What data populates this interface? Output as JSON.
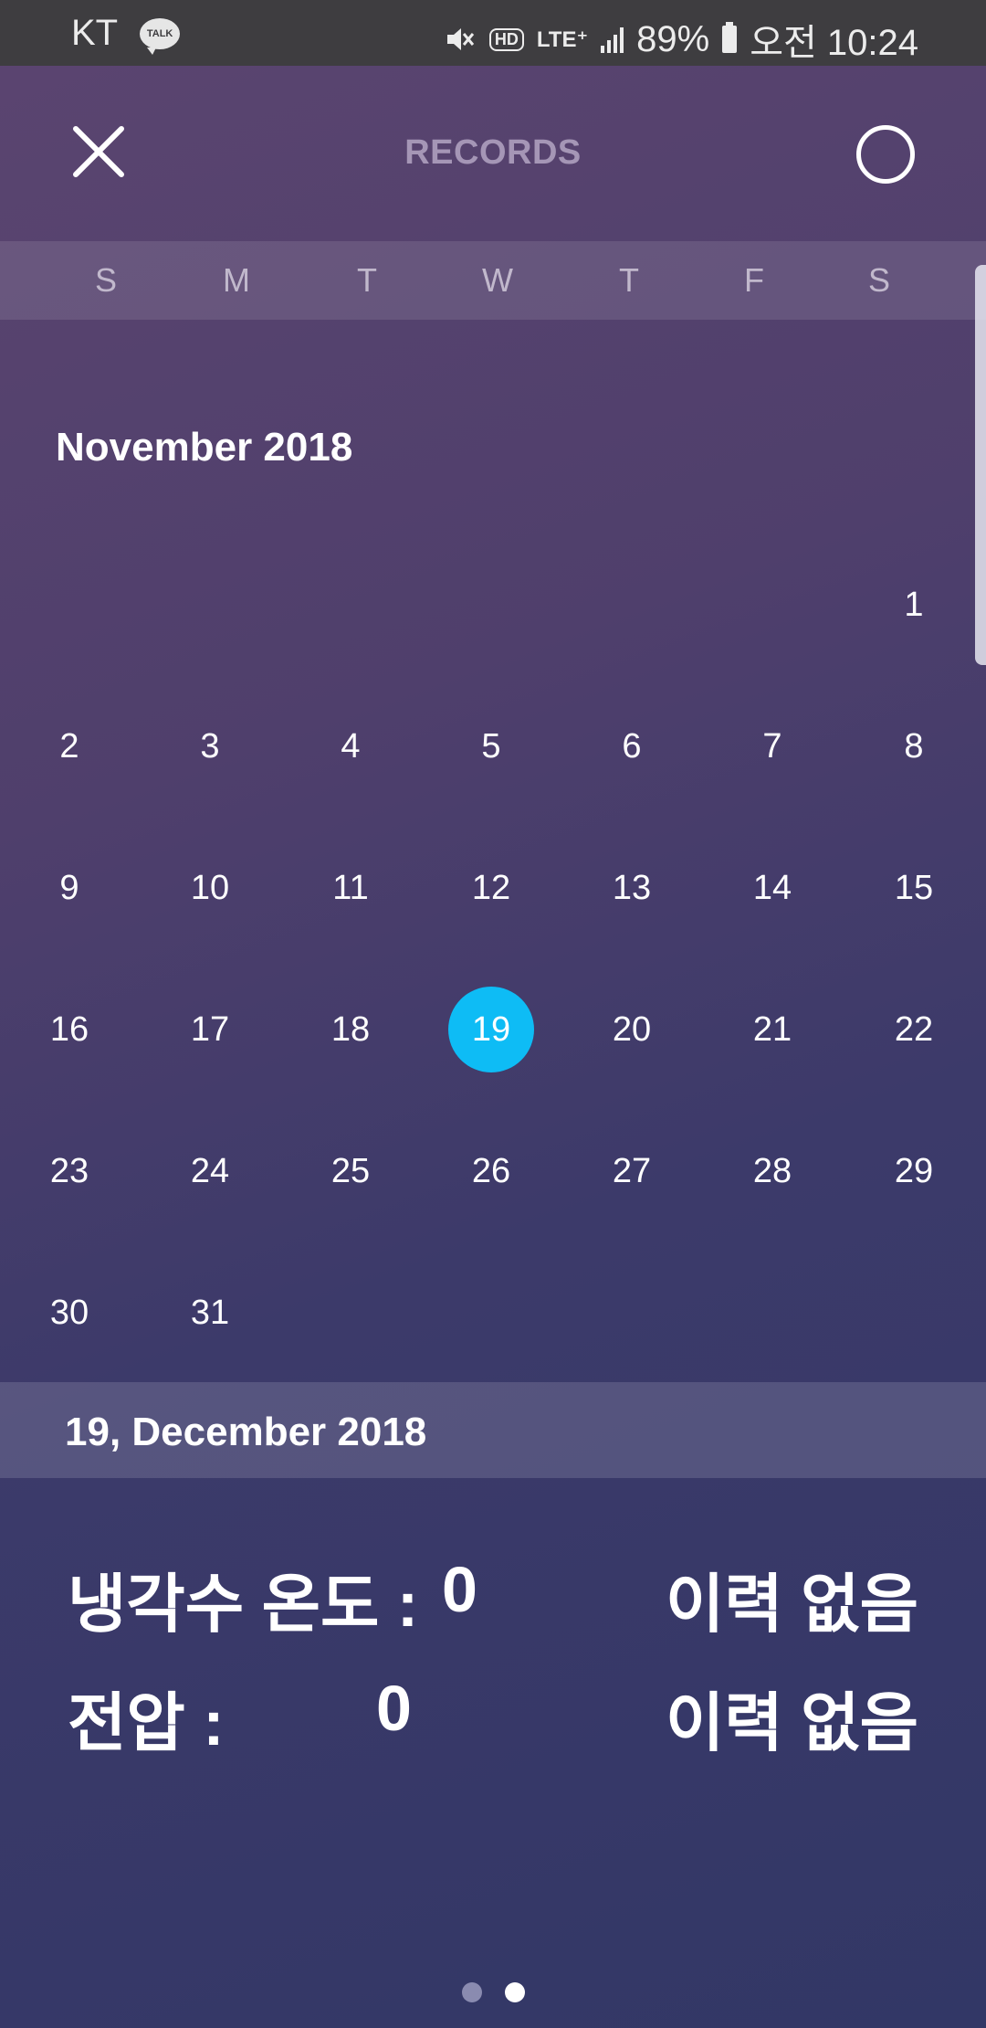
{
  "status_bar": {
    "carrier": "KT",
    "talk_label": "TALK",
    "mute_icon": "mute-icon",
    "hd_label": "HD",
    "lte_label": "LTE⁺",
    "battery": "89%",
    "time": "오전 10:24"
  },
  "header": {
    "title": "RECORDS",
    "close_icon": "close-icon",
    "circle_icon": "circle-icon"
  },
  "weekdays": [
    "S",
    "M",
    "T",
    "W",
    "T",
    "F",
    "S"
  ],
  "calendar": {
    "month_title": "November 2018",
    "selected_day": 19,
    "days": [
      "1",
      "2",
      "3",
      "4",
      "5",
      "6",
      "7",
      "8",
      "9",
      "10",
      "11",
      "12",
      "13",
      "14",
      "15",
      "16",
      "17",
      "18",
      "19",
      "20",
      "21",
      "22",
      "23",
      "24",
      "25",
      "26",
      "27",
      "28",
      "29",
      "30",
      "31"
    ]
  },
  "selected_date_label": "19, December 2018",
  "records": [
    {
      "label": "냉각수 온도 :",
      "value": "0",
      "status": "이력 없음"
    },
    {
      "label": "전압 :",
      "value": "0",
      "status": "이력 없음"
    }
  ],
  "pager": {
    "count": 2,
    "active_index": 1
  },
  "colors": {
    "selected_day": "#0ebcf5",
    "title_muted": "#a596b6",
    "status_bar_bg": "#3e3d40"
  }
}
